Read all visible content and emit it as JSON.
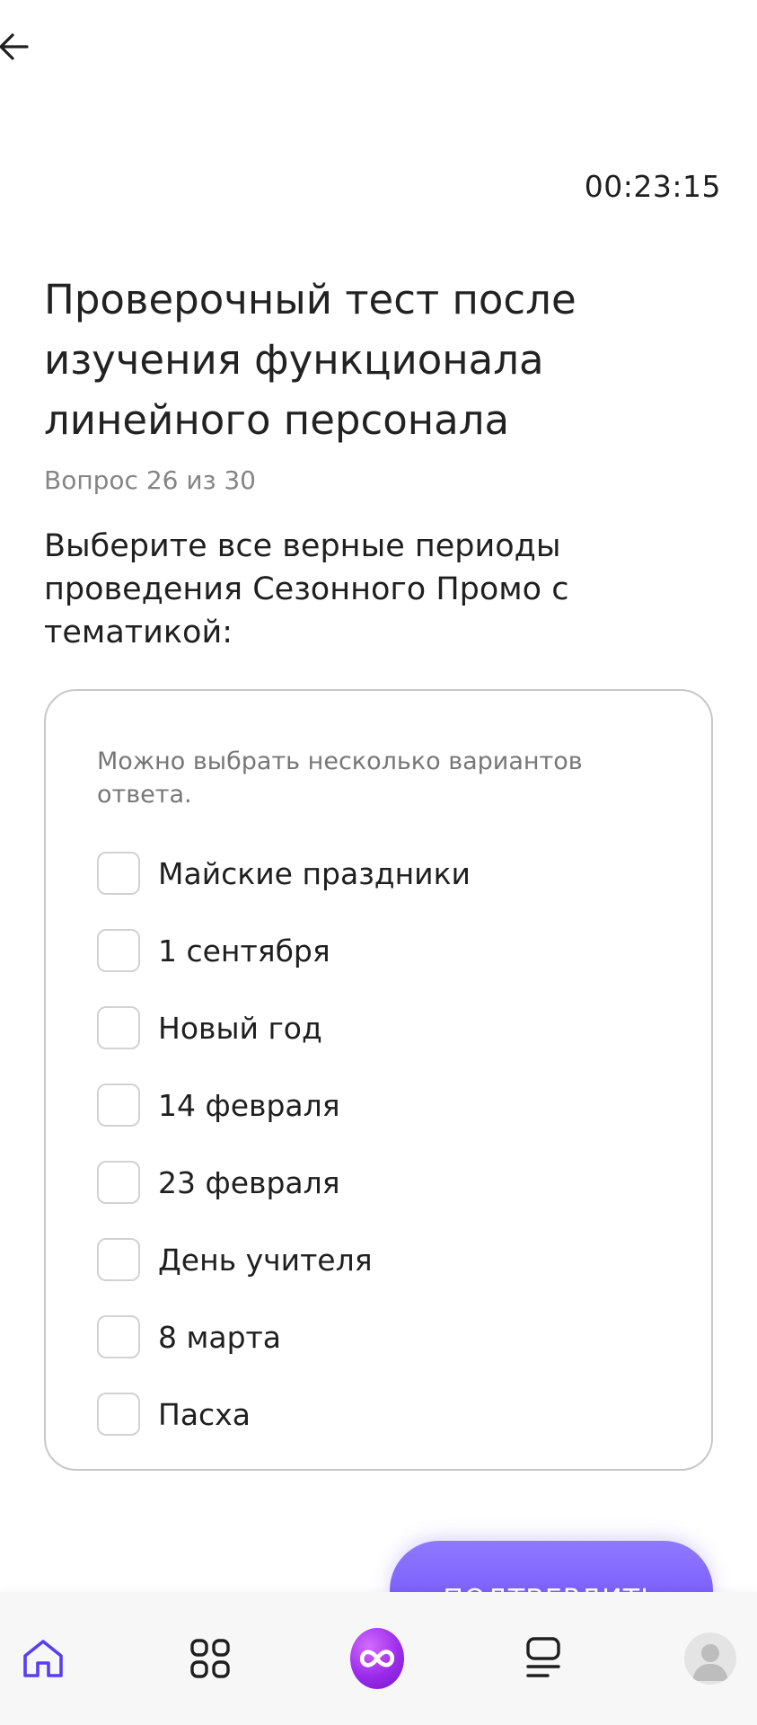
{
  "header": {
    "back_icon": "arrow-left-icon",
    "timer": "00:23:15"
  },
  "test": {
    "title": "Проверочный тест после изучения функционала линейного персонала",
    "progress": "Вопрос 26 из 30",
    "question": "Выберите все верные периоды проведения Сезонного Промо с тематикой:",
    "hint": "Можно выбрать несколько вариантов ответа.",
    "options": [
      {
        "label": "Майские праздники",
        "checked": false
      },
      {
        "label": "1 сентября",
        "checked": false
      },
      {
        "label": "Новый год",
        "checked": false
      },
      {
        "label": "14 февраля",
        "checked": false
      },
      {
        "label": "23 февраля",
        "checked": false
      },
      {
        "label": "День учителя",
        "checked": false
      },
      {
        "label": "8 марта",
        "checked": false
      },
      {
        "label": "Пасха",
        "checked": false
      }
    ]
  },
  "actions": {
    "confirm_label": "Подтвердить"
  },
  "bottom_nav": {
    "items": [
      {
        "icon": "home-icon",
        "active": true
      },
      {
        "icon": "apps-grid-icon",
        "active": false
      },
      {
        "icon": "infinity-logo-icon",
        "active": false
      },
      {
        "icon": "courses-icon",
        "active": false
      },
      {
        "icon": "avatar-icon",
        "active": false
      }
    ]
  },
  "colors": {
    "accent": "#6d4cf5",
    "nav_active": "#5b3df0",
    "muted_text": "#858585",
    "border": "#c8c8c8"
  }
}
